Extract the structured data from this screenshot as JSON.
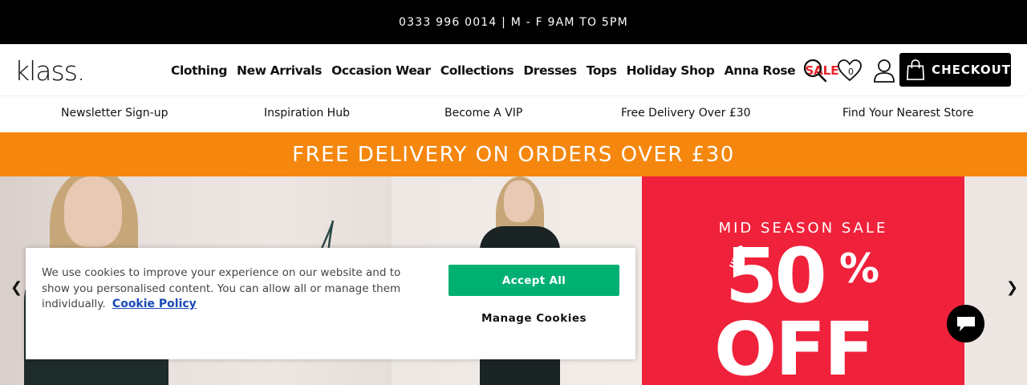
{
  "topbar": {
    "text": "0333 996 0014 | M - F 9AM TO 5PM"
  },
  "header": {
    "logo": "klass.",
    "nav": [
      "Clothing",
      "New Arrivals",
      "Occasion Wear",
      "Collections",
      "Dresses",
      "Tops",
      "Holiday Shop",
      "Anna Rose",
      "SALE"
    ],
    "wishlist_count": "0",
    "checkout_label": "CHECKOUT"
  },
  "subnav": [
    "Newsletter Sign-up",
    "Inspiration Hub",
    "Become A VIP",
    "Free Delivery Over £30",
    "Find Your Nearest Store"
  ],
  "promo": {
    "text": "FREE DELIVERY ON ORDERS OVER £30"
  },
  "hero": {
    "sale_title": "MID SEASON SALE",
    "sale_upto": "UPTO",
    "sale_number": "50",
    "sale_percent": "%",
    "sale_off": "OFF",
    "prev_arrow": "❮",
    "next_arrow": "❯"
  },
  "cookie": {
    "text": "We use cookies to improve your experience on our website and to show you personalised content. You can allow all or manage them individually.",
    "policy_link": "Cookie Policy",
    "accept_label": "Accept All",
    "manage_label": "Manage Cookies"
  },
  "colors": {
    "promo": "#f5870e",
    "sale_red": "#e8272a",
    "accept_green": "#00b073",
    "link_blue": "#1a4ab8"
  },
  "icons": [
    "search-icon",
    "heart-icon",
    "user-icon",
    "shopping-bag-icon",
    "chat-icon"
  ]
}
